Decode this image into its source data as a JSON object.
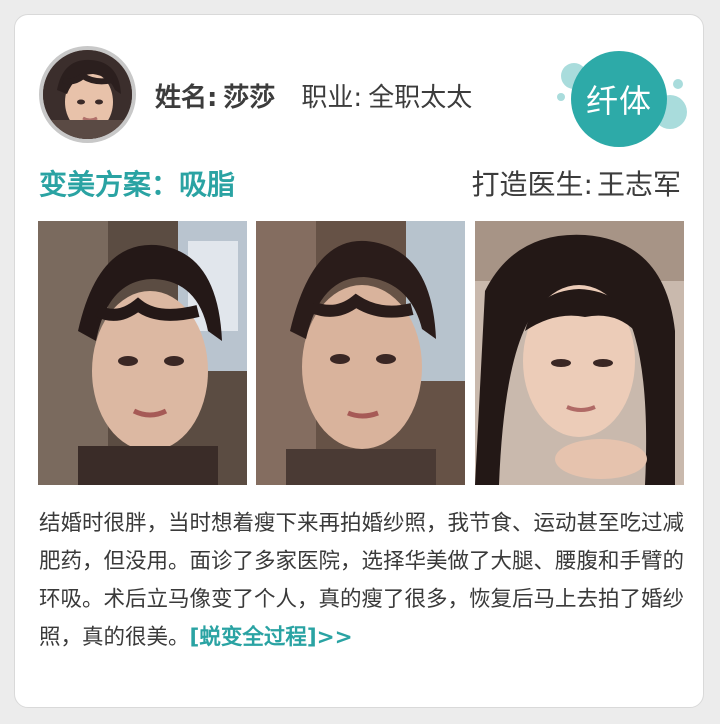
{
  "profile": {
    "name_label": "姓名:",
    "name_value": "莎莎",
    "job_label": "职业:",
    "job_value": "全职太太",
    "avatar_alt": "avatar"
  },
  "badge": {
    "text": "纤体",
    "color": "#2daaa8"
  },
  "plan": {
    "label": "变美方案：吸脂",
    "color": "#2aa3a3"
  },
  "doctor": {
    "label": "打造医生:",
    "name": "王志军"
  },
  "photos": [
    {
      "name": "photo-before-1"
    },
    {
      "name": "photo-before-2"
    },
    {
      "name": "photo-after"
    }
  ],
  "description": {
    "text": "结婚时很胖，当时想着瘦下来再拍婚纱照，我节食、运动甚至吃过减肥药，但没用。面诊了多家医院，选择华美做了大腿、腰腹和手臂的环吸。术后立马像变了个人，真的瘦了很多，恢复后马上去拍了婚纱照，真的很美。",
    "link": "[蜕变全过程]>>"
  }
}
